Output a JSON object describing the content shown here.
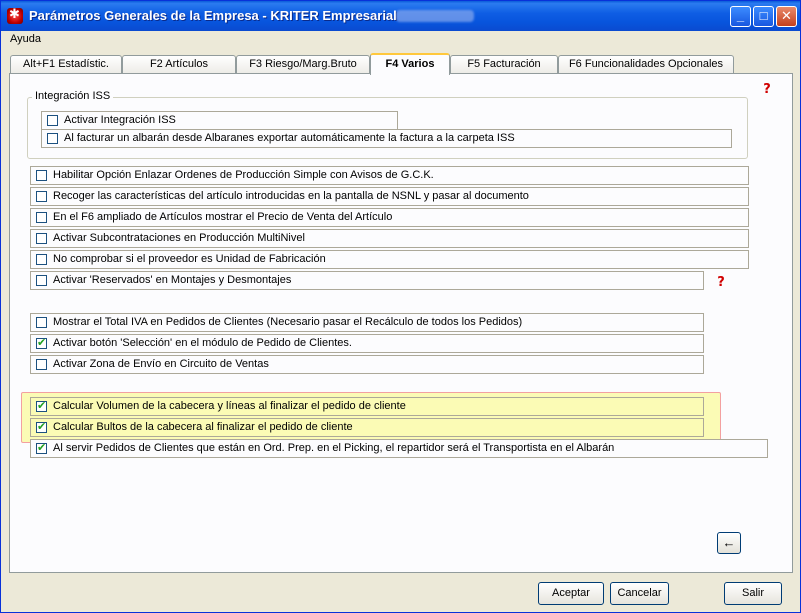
{
  "window": {
    "title": "Parámetros Generales de la Empresa - KRITER Empresarial",
    "controls": {
      "minimize": "_",
      "maximize": "□",
      "close": "✕"
    }
  },
  "menu": {
    "items": [
      "Ayuda"
    ]
  },
  "tabs": [
    {
      "label": "Alt+F1 Estadístic."
    },
    {
      "label": "F2 Artículos"
    },
    {
      "label": "F3 Riesgo/Marg.Bruto"
    },
    {
      "label": "F4 Varios",
      "active": true
    },
    {
      "label": "F5 Facturación"
    },
    {
      "label": "F6 Funcionalidades Opcionales"
    }
  ],
  "iss_group": {
    "title": "Integración ISS",
    "options": [
      {
        "label": "Activar Integración ISS",
        "checked": false
      },
      {
        "label": "Al facturar un albarán desde Albaranes exportar automáticamente la factura a la carpeta ISS",
        "checked": false
      }
    ]
  },
  "group2": [
    {
      "label": "Habilitar Opción Enlazar Ordenes de Producción Simple con Avisos de G.C.K.",
      "checked": false
    },
    {
      "label": "Recoger las características del artículo introducidas en la pantalla de NSNL y pasar al documento",
      "checked": false
    },
    {
      "label": "En el F6 ampliado de Artículos mostrar el Precio de Venta del Artículo",
      "checked": false
    },
    {
      "label": "Activar Subcontrataciones en Producción MultiNivel",
      "checked": false
    },
    {
      "label": "No comprobar si el proveedor es Unidad de Fabricación",
      "checked": false
    },
    {
      "label": "Activar 'Reservados' en Montajes y Desmontajes",
      "checked": false
    }
  ],
  "group3": [
    {
      "label": "Mostrar el Total IVA en Pedidos de Clientes (Necesario pasar el Recálculo de todos los Pedidos)",
      "checked": false
    },
    {
      "label": "Activar botón 'Selección' en el módulo de Pedido de Clientes.",
      "checked": true
    },
    {
      "label": "Activar Zona de Envío en Circuito de Ventas",
      "checked": false
    }
  ],
  "group4": [
    {
      "label": "Calcular Volumen de la cabecera y líneas al finalizar el pedido de cliente",
      "checked": true
    },
    {
      "label": "Calcular Bultos de la cabecera al finalizar el pedido de cliente",
      "checked": true
    },
    {
      "label": "Al servir Pedidos de Clientes que están en Ord. Prep. en el Picking, el repartidor será el Transportista en el Albarán",
      "checked": true
    }
  ],
  "help_glyph": "?",
  "back_glyph": "←",
  "buttons": {
    "accept": "Aceptar",
    "cancel": "Cancelar",
    "exit": "Salir"
  },
  "colors": {
    "titlebar": "#0a5bd9",
    "highlight": "#fafa78",
    "check": "#21a121",
    "help": "#d00000"
  }
}
